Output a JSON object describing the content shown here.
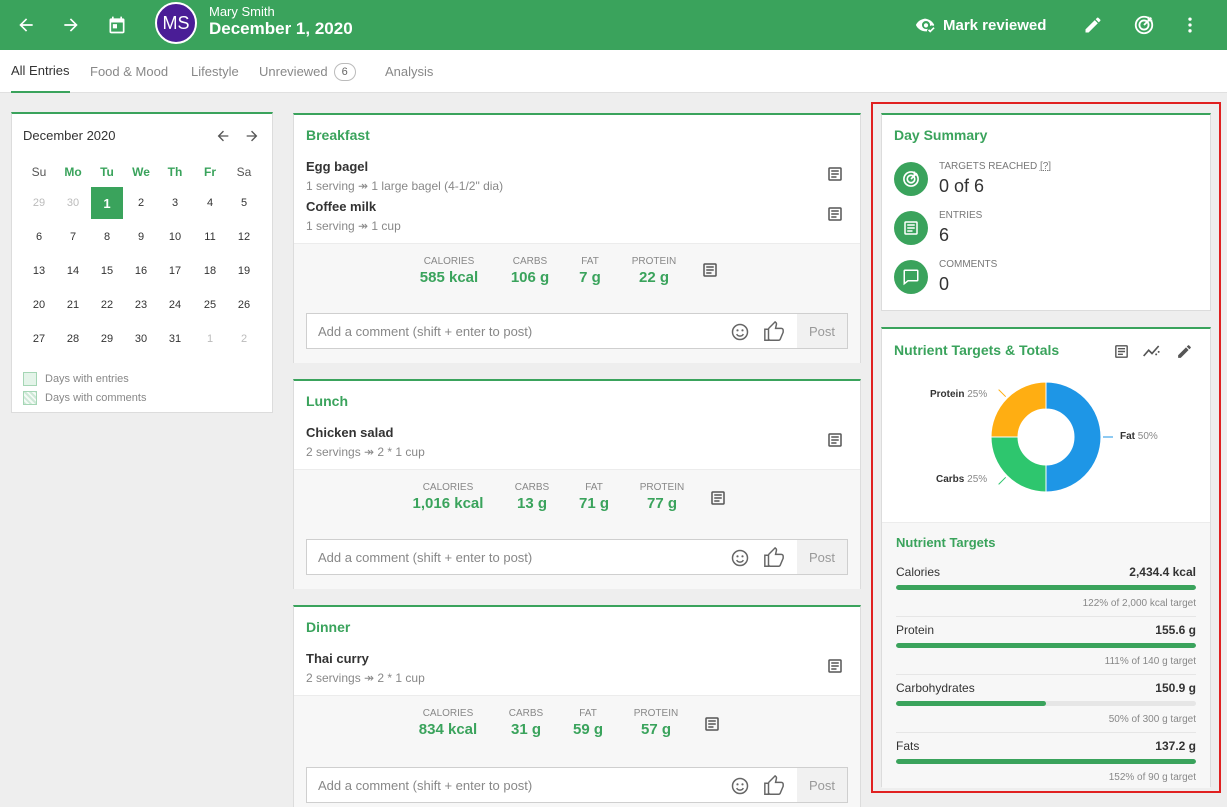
{
  "header": {
    "user_initials": "MS",
    "user_name": "Mary Smith",
    "date": "December 1, 2020",
    "mark_reviewed_label": "Mark reviewed",
    "accent": "#3aa35c",
    "avatar_color": "#4a1d96"
  },
  "tabs": [
    {
      "label": "All Entries",
      "active": true
    },
    {
      "label": "Food & Mood"
    },
    {
      "label": "Lifestyle"
    },
    {
      "label": "Unreviewed",
      "badge": "6"
    },
    {
      "label": "Analysis"
    }
  ],
  "calendar": {
    "month_label": "December 2020",
    "days_of_week": [
      "Su",
      "Mo",
      "Tu",
      "We",
      "Th",
      "Fr",
      "Sa"
    ],
    "weeks": [
      [
        "29",
        "30",
        "1",
        "2",
        "3",
        "4",
        "5"
      ],
      [
        "6",
        "7",
        "8",
        "9",
        "10",
        "11",
        "12"
      ],
      [
        "13",
        "14",
        "15",
        "16",
        "17",
        "18",
        "19"
      ],
      [
        "20",
        "21",
        "22",
        "23",
        "24",
        "25",
        "26"
      ],
      [
        "27",
        "28",
        "29",
        "30",
        "31",
        "1",
        "2"
      ]
    ],
    "legend_entries": "Days with entries",
    "legend_comments": "Days with comments"
  },
  "meals": [
    {
      "title": "Breakfast",
      "foods": [
        {
          "name": "Egg bagel",
          "desc": "1 serving ↠ 1 large bagel (4-1/2\" dia)"
        },
        {
          "name": "Coffee milk",
          "desc": "1 serving ↠ 1 cup"
        }
      ],
      "nutrients": {
        "calories": "585 kcal",
        "carbs": "106 g",
        "fat": "7 g",
        "protein": "22 g"
      }
    },
    {
      "title": "Lunch",
      "foods": [
        {
          "name": "Chicken salad",
          "desc": "2 servings ↠ 2 * 1 cup"
        }
      ],
      "nutrients": {
        "calories": "1,016 kcal",
        "carbs": "13 g",
        "fat": "71 g",
        "protein": "77 g"
      }
    },
    {
      "title": "Dinner",
      "foods": [
        {
          "name": "Thai curry",
          "desc": "2 servings ↠ 2 * 1 cup"
        }
      ],
      "nutrients": {
        "calories": "834 kcal",
        "carbs": "31 g",
        "fat": "59 g",
        "protein": "57 g"
      }
    }
  ],
  "nutrient_labels": {
    "calories": "CALORIES",
    "carbs": "CARBS",
    "fat": "FAT",
    "protein": "PROTEIN"
  },
  "comment": {
    "placeholder": "Add a comment (shift + enter to post)",
    "post_label": "Post"
  },
  "day_summary": {
    "title": "Day Summary",
    "targets_label": "TARGETS REACHED",
    "targets_help": "[?]",
    "targets_value": "0 of 6",
    "entries_label": "ENTRIES",
    "entries_value": "6",
    "comments_label": "COMMENTS",
    "comments_value": "0"
  },
  "nutrient_targets": {
    "title": "Nutrient Targets & Totals",
    "subtitle": "Nutrient Targets",
    "rows": [
      {
        "name": "Calories",
        "amount": "2,434.4 kcal",
        "note": "122% of 2,000 kcal target",
        "percent": 122
      },
      {
        "name": "Protein",
        "amount": "155.6 g",
        "note": "111% of 140 g target",
        "percent": 111
      },
      {
        "name": "Carbohydrates",
        "amount": "150.9 g",
        "note": "50% of 300 g target",
        "percent": 50
      },
      {
        "name": "Fats",
        "amount": "137.2 g",
        "note": "152% of 90 g target",
        "percent": 152
      }
    ]
  },
  "chart_data": {
    "type": "pie",
    "donut": true,
    "series": [
      {
        "name": "Fat",
        "value": 50,
        "label": "50%",
        "color": "#1e96e6"
      },
      {
        "name": "Carbs",
        "value": 25,
        "label": "25%",
        "color": "#2ec66e"
      },
      {
        "name": "Protein",
        "value": 25,
        "label": "25%",
        "color": "#ffae12"
      }
    ]
  }
}
